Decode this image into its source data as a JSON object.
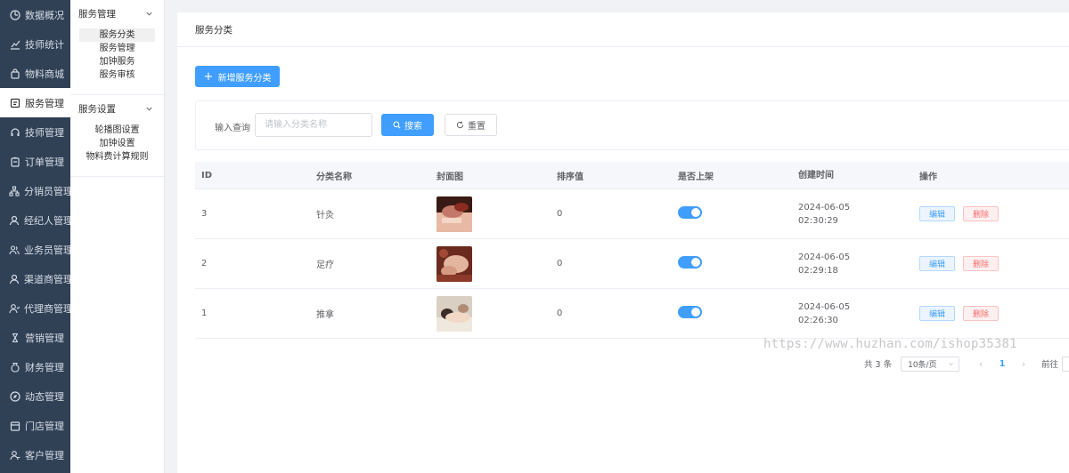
{
  "sidebar": {
    "items": [
      {
        "label": "数据概况",
        "icon": "dashboard-icon"
      },
      {
        "label": "技师统计",
        "icon": "chart-icon"
      },
      {
        "label": "物料商城",
        "icon": "bag-icon"
      },
      {
        "label": "服务管理",
        "icon": "service-icon",
        "active": true
      },
      {
        "label": "技师管理",
        "icon": "headset-icon"
      },
      {
        "label": "订单管理",
        "icon": "clipboard-icon"
      },
      {
        "label": "分销员管理",
        "icon": "network-icon"
      },
      {
        "label": "经纪人管理",
        "icon": "person-icon"
      },
      {
        "label": "业务员管理",
        "icon": "people-icon"
      },
      {
        "label": "渠道商管理",
        "icon": "channel-icon"
      },
      {
        "label": "代理商管理",
        "icon": "agent-icon"
      },
      {
        "label": "营销管理",
        "icon": "hourglass-icon"
      },
      {
        "label": "财务管理",
        "icon": "money-icon"
      },
      {
        "label": "动态管理",
        "icon": "compass-icon"
      },
      {
        "label": "门店管理",
        "icon": "store-icon"
      },
      {
        "label": "客户管理",
        "icon": "customer-icon"
      }
    ]
  },
  "submenu": {
    "groups": [
      {
        "title": "服务管理",
        "items": [
          "服务分类",
          "服务管理",
          "加钟服务",
          "服务审核"
        ]
      },
      {
        "title": "服务设置",
        "items": [
          "轮播图设置",
          "加钟设置",
          "物料费计算规则"
        ]
      }
    ],
    "active_item": "服务分类"
  },
  "breadcrumb": "服务分类",
  "toolbar": {
    "add_label": "新增服务分类"
  },
  "search": {
    "label": "输入查询",
    "placeholder": "请输入分类名称",
    "search_label": "搜索",
    "reset_label": "重置"
  },
  "table": {
    "headers": [
      "ID",
      "分类名称",
      "封面图",
      "排序值",
      "是否上架",
      "创建时间",
      "操作"
    ],
    "rows": [
      {
        "id": "3",
        "name": "针灸",
        "sort": "0",
        "on_shelf": true,
        "date": "2024-06-05",
        "time": "02:30:29"
      },
      {
        "id": "2",
        "name": "足疗",
        "sort": "0",
        "on_shelf": true,
        "date": "2024-06-05",
        "time": "02:29:18"
      },
      {
        "id": "1",
        "name": "推拿",
        "sort": "0",
        "on_shelf": true,
        "date": "2024-06-05",
        "time": "02:26:30"
      }
    ],
    "edit_label": "编辑",
    "delete_label": "删除"
  },
  "pagination": {
    "total_text": "共 3 条",
    "page_size": "10条/页",
    "current_page": "1",
    "goto_label": "前往"
  },
  "watermark": "https://www.huzhan.com/ishop35381",
  "colors": {
    "primary": "#409eff",
    "sidebar_bg": "#304156",
    "danger": "#f56c6c"
  }
}
